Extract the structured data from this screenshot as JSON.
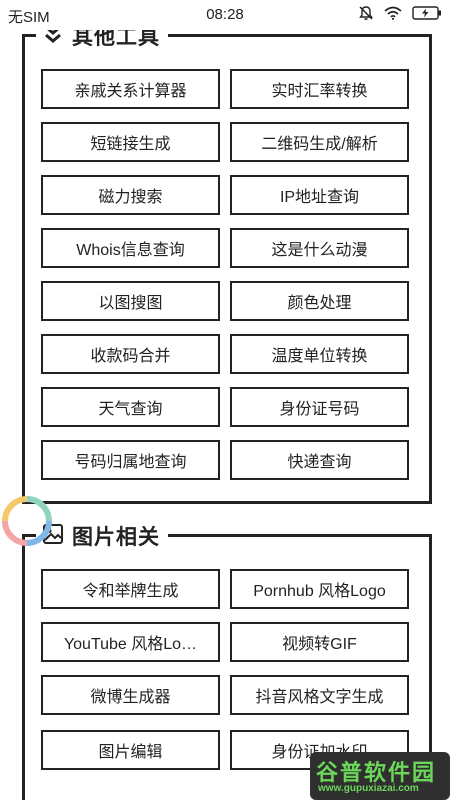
{
  "status_bar": {
    "carrier": "无SIM",
    "time": "08:28",
    "icons": [
      "mute-icon",
      "wifi-icon",
      "battery-charging-icon"
    ]
  },
  "sections": [
    {
      "title": "其他工具",
      "icon": "chevron-double-down-icon",
      "tools": [
        {
          "label": "亲戚关系计算器"
        },
        {
          "label": "实时汇率转换"
        },
        {
          "label": "短链接生成"
        },
        {
          "label": "二维码生成/解析"
        },
        {
          "label": "磁力搜索"
        },
        {
          "label": "IP地址查询"
        },
        {
          "label": "Whois信息查询"
        },
        {
          "label": "这是什么动漫"
        },
        {
          "label": "以图搜图"
        },
        {
          "label": "颜色处理"
        },
        {
          "label": "收款码合并"
        },
        {
          "label": "温度单位转换"
        },
        {
          "label": "天气查询"
        },
        {
          "label": "身份证号码"
        },
        {
          "label": "号码归属地查询"
        },
        {
          "label": "快递查询"
        }
      ]
    },
    {
      "title": "图片相关",
      "icon": "image-icon",
      "tools": [
        {
          "label": "令和举牌生成"
        },
        {
          "label": "Pornhub 风格Logo"
        },
        {
          "label": "YouTube 风格Lo…"
        },
        {
          "label": "视频转GIF"
        },
        {
          "label": "微博生成器"
        },
        {
          "label": "抖音风格文字生成"
        },
        {
          "label": "图片编辑"
        },
        {
          "label": "身份证加水印"
        }
      ]
    }
  ],
  "loader": {
    "icon": "loading-spinner-icon",
    "colors": [
      "#f2a6a6",
      "#f5c96b",
      "#8fd3c1",
      "#7fb7e6"
    ]
  },
  "watermark": {
    "main": "谷普软件园",
    "sub": "www.gupuxiazai.com",
    "color": "#6cd65a"
  }
}
